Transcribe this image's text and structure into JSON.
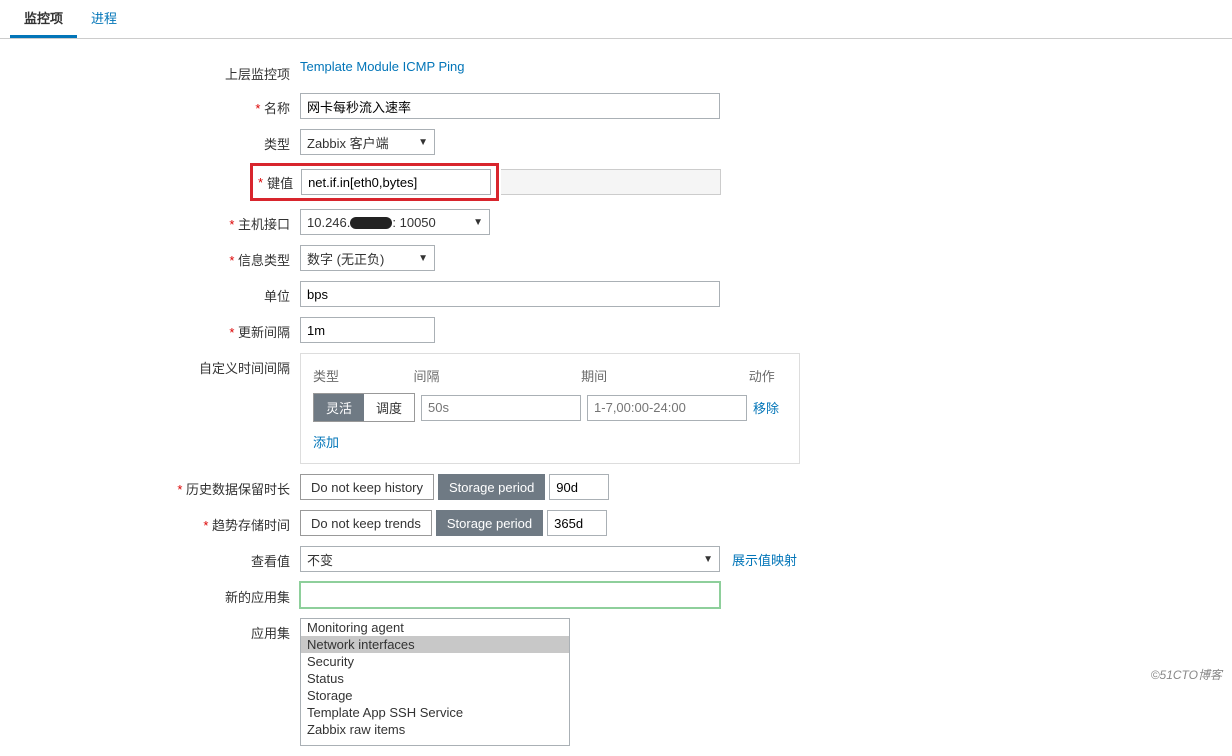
{
  "tabs": {
    "monitor": "监控项",
    "process": "进程"
  },
  "parent": {
    "label": "上层监控项",
    "link": "Template Module ICMP Ping"
  },
  "name": {
    "label": "名称",
    "value": "网卡每秒流入速率"
  },
  "type": {
    "label": "类型",
    "value": "Zabbix 客户端"
  },
  "key": {
    "label": "键值",
    "value": "net.if.in[eth0,bytes]"
  },
  "iface": {
    "label": "主机接口",
    "ip_prefix": "10.246",
    "port": ": 10050"
  },
  "info": {
    "label": "信息类型",
    "value": "数字 (无正负)"
  },
  "unit": {
    "label": "单位",
    "value": "bps"
  },
  "update": {
    "label": "更新间隔",
    "value": "1m"
  },
  "custom": {
    "label": "自定义时间间隔",
    "cols": {
      "type": "类型",
      "interval": "间隔",
      "period": "期间",
      "action": "动作"
    },
    "seg": {
      "flex": "灵活",
      "sched": "调度"
    },
    "ph_interval": "50s",
    "ph_period": "1-7,00:00-24:00",
    "remove": "移除",
    "add": "添加"
  },
  "history": {
    "label": "历史数据保留时长",
    "btn1": "Do not keep history",
    "btn2": "Storage period",
    "value": "90d"
  },
  "trends": {
    "label": "趋势存储时间",
    "btn1": "Do not keep trends",
    "btn2": "Storage period",
    "value": "365d"
  },
  "view": {
    "label": "查看值",
    "value": "不变",
    "link": "展示值映射"
  },
  "newapp": {
    "label": "新的应用集",
    "value": ""
  },
  "apps": {
    "label": "应用集",
    "items": [
      "Monitoring agent",
      "Network interfaces",
      "Security",
      "Status",
      "Storage",
      "Template App SSH Service",
      "Zabbix raw items"
    ],
    "selected": 1
  },
  "watermark": "©51CTO博客"
}
